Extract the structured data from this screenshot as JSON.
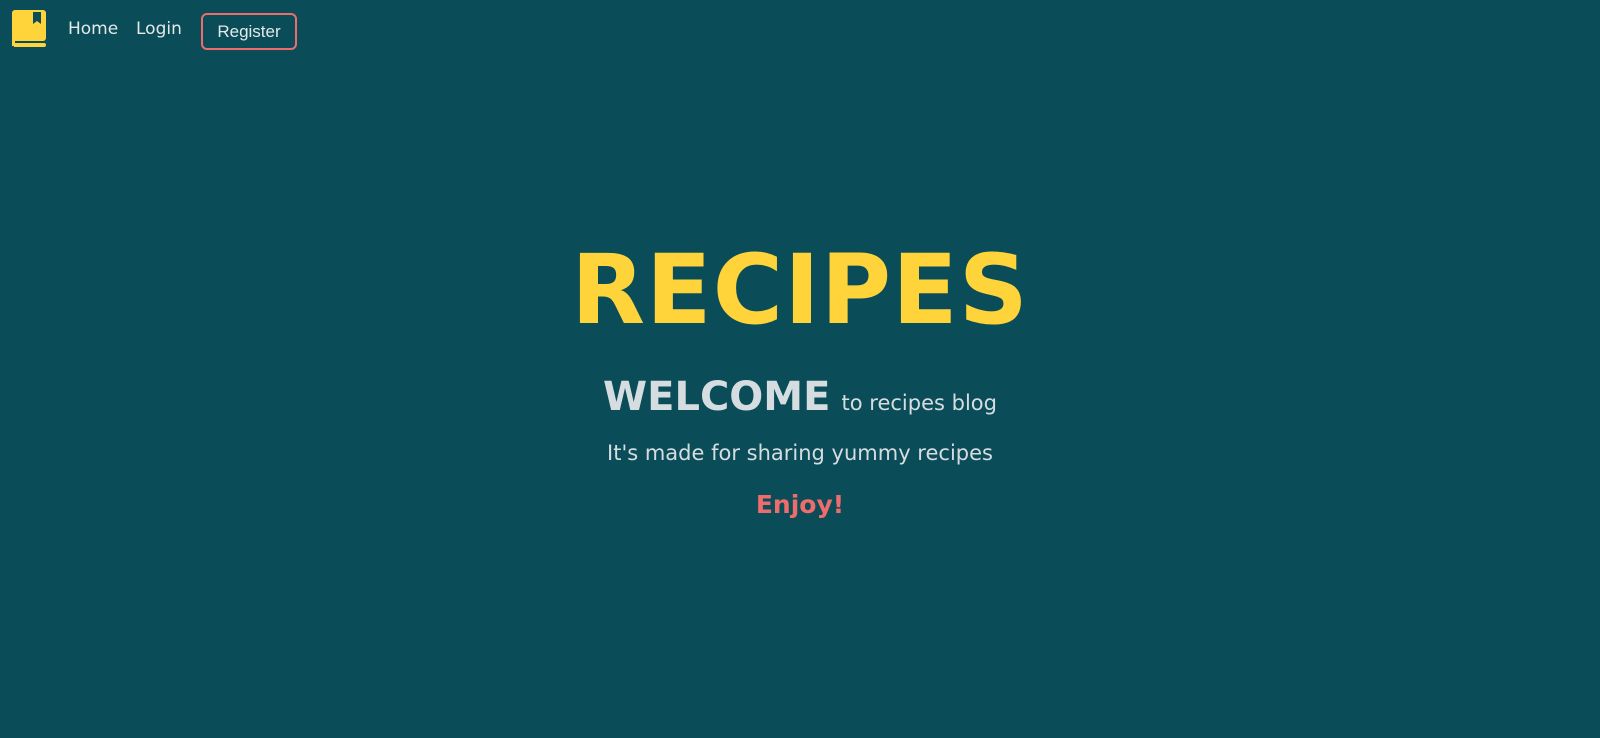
{
  "nav": {
    "logo_icon": "book-icon",
    "home_label": "Home",
    "login_label": "Login",
    "register_label": "Register"
  },
  "hero": {
    "title": "RECIPES",
    "welcome_big": "WELCOME",
    "welcome_small": "to recipes blog",
    "tagline": "It's made for sharing yummy recipes",
    "enjoy": "Enjoy!"
  },
  "colors": {
    "background": "#0a4d58",
    "accent_yellow": "#ffd43b",
    "accent_red": "#ef6c6c",
    "text_light": "#d6dde1"
  }
}
